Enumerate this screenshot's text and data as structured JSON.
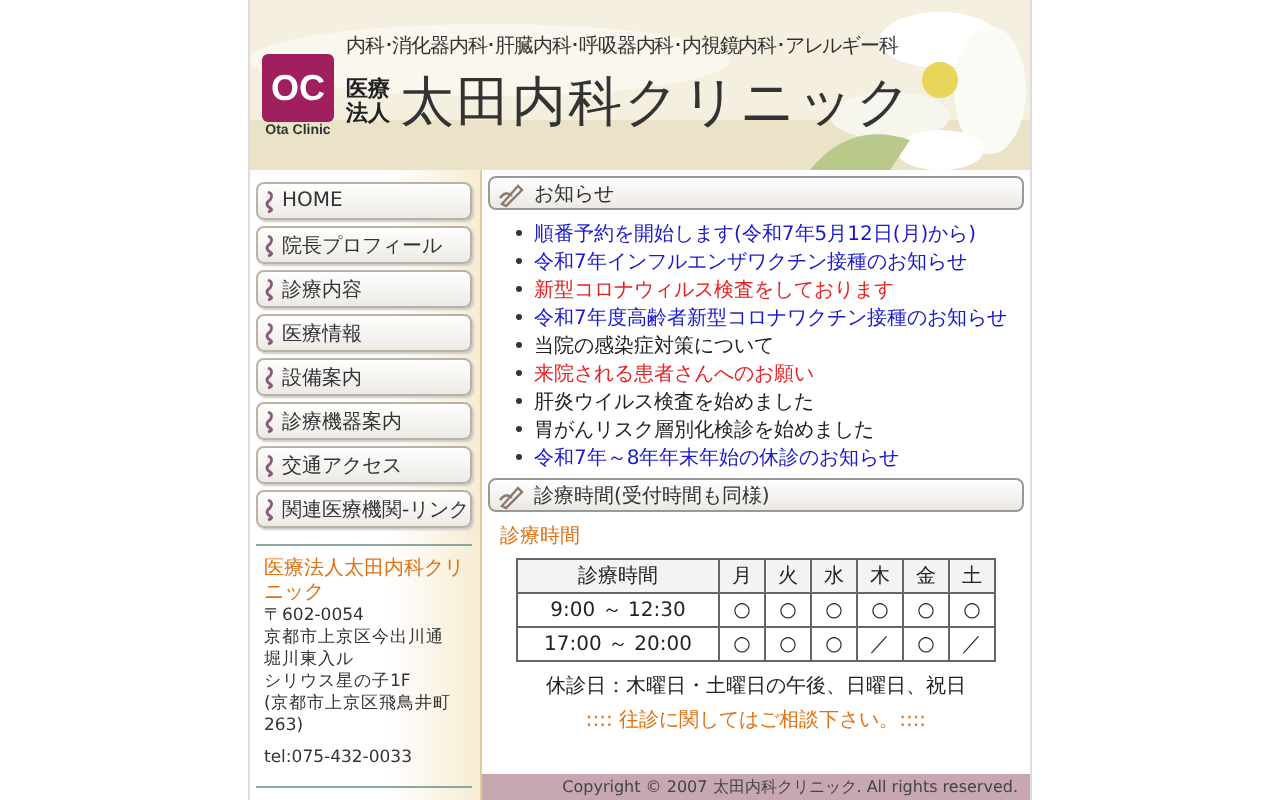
{
  "header": {
    "logo_mark": "OC",
    "logo_caption": "Ota Clinic",
    "departments": "内科･消化器内科･肝臓内科･呼吸器内科･内視鏡内科･アレルギー科",
    "corp_line_1": "医療",
    "corp_line_2": "法人",
    "clinic_name": "太田内科クリニック"
  },
  "sidebar": {
    "items": [
      {
        "label": "HOME"
      },
      {
        "label": "院長プロフィール"
      },
      {
        "label": "診療内容"
      },
      {
        "label": "医療情報"
      },
      {
        "label": "設備案内"
      },
      {
        "label": "診療機器案内"
      },
      {
        "label": "交通アクセス"
      },
      {
        "label": "関連医療機関-リンク"
      }
    ],
    "address": {
      "name": "医療法人太田内科クリニック",
      "lines": [
        "〒602-0054",
        "京都市上京区今出川通",
        "堀川東入ル",
        "シリウス星の子1F",
        "(京都市上京区飛鳥井町263)"
      ],
      "tel": "tel:075-432-0033"
    }
  },
  "news": {
    "title": "お知らせ",
    "items": [
      {
        "text": "順番予約を開始します(令和7年5月12日(月)から)",
        "color": "#1a1acc"
      },
      {
        "text": "令和7年インフルエンザワクチン接種のお知らせ",
        "color": "#1a1acc"
      },
      {
        "text": "新型コロナウィルス検査をしております",
        "color": "#e82020"
      },
      {
        "text": "令和7年度高齢者新型コロナワクチン接種のお知らせ",
        "color": "#1a1acc"
      },
      {
        "text": "当院の感染症対策について",
        "color": "#222222"
      },
      {
        "text": "来院される患者さんへのお願い",
        "color": "#e82020"
      },
      {
        "text": "肝炎ウイルス検査を始めました",
        "color": "#222222"
      },
      {
        "text": "胃がんリスク層別化検診を始めました",
        "color": "#222222"
      },
      {
        "text": "令和7年～8年年末年始の休診のお知らせ",
        "color": "#1a1acc"
      }
    ]
  },
  "hours": {
    "title": "診療時間(受付時間も同様)",
    "subtitle": "診療時間",
    "table": {
      "columns": [
        "診療時間",
        "月",
        "火",
        "水",
        "木",
        "金",
        "土"
      ],
      "rows": [
        [
          "9:00 ～ 12:30",
          "○",
          "○",
          "○",
          "○",
          "○",
          "○"
        ],
        [
          "17:00 ～ 20:00",
          "○",
          "○",
          "○",
          "／",
          "○",
          "／"
        ]
      ]
    },
    "closed": "休診日：木曜日・土曜日の午後、日曜日、祝日",
    "note": ":::: 往診に関してはご相談下さい。::::"
  },
  "footer": {
    "copyright": "Copyright © 2007 太田内科クリニック. All rights reserved."
  }
}
